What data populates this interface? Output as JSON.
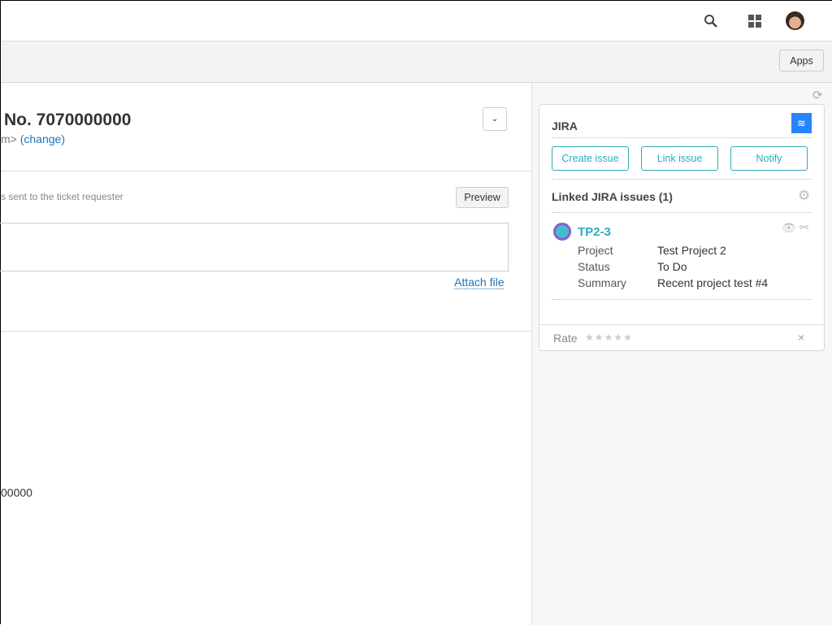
{
  "topbar": {
    "icons": [
      "search-icon",
      "apps-grid-icon",
      "user-avatar"
    ]
  },
  "subbar": {
    "apps_label": "Apps"
  },
  "ticket": {
    "title": "No. 7070000000",
    "requester_partial": "m>",
    "change_link": "(change)",
    "reply_hint": "s sent to the ticket requester",
    "preview_label": "Preview",
    "attach_label": "Attach file",
    "field_partial": "00000"
  },
  "jira": {
    "title": "JIRA",
    "buttons": [
      "Create issue",
      "Link issue",
      "Notify"
    ],
    "linked_heading": "Linked JIRA issues (1)",
    "issue": {
      "key": "TP2-3",
      "fields": [
        {
          "label": "Project",
          "value": "Test Project 2"
        },
        {
          "label": "Status",
          "value": "To Do"
        },
        {
          "label": "Summary",
          "value": "Recent project test #4"
        }
      ]
    },
    "rate_label": "Rate",
    "rating": 0,
    "max_rating": 5,
    "accent": "#30aabc",
    "logo_color": "#2684ff"
  }
}
